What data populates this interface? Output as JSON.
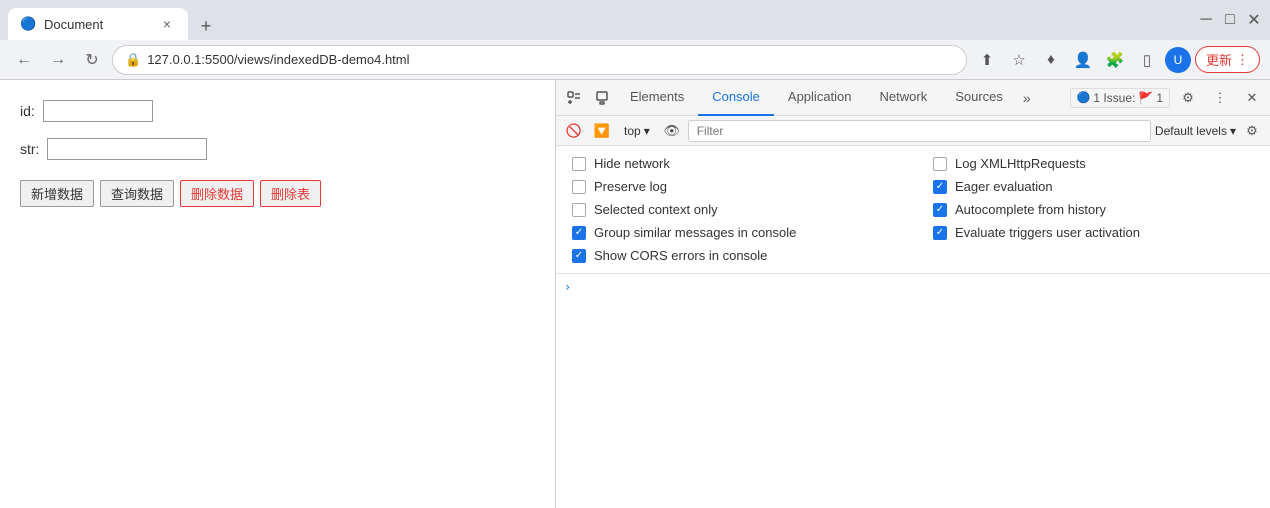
{
  "browser": {
    "tab_title": "Document",
    "tab_favicon": "🔵",
    "address": "127.0.0.1:5500/views/indexedDB-demo4.html",
    "update_btn": "更新",
    "new_tab_icon": "+",
    "nav_back": "←",
    "nav_forward": "→",
    "nav_reload": "↻"
  },
  "window_controls": {
    "minimize": "─",
    "maximize": "□",
    "close": "✕"
  },
  "page": {
    "id_label": "id:",
    "id_placeholder": "",
    "str_label": "str:",
    "str_placeholder": "",
    "btn_add": "新增数据",
    "btn_query": "查询数据",
    "btn_delete_data": "删除数据",
    "btn_delete_table": "删除表"
  },
  "devtools": {
    "tabs": [
      "Elements",
      "Console",
      "Application",
      "Network",
      "Sources",
      "»"
    ],
    "active_tab": "Console",
    "issues_label": "1 Issue:",
    "issues_count": "1",
    "toolbar": {
      "top_label": "top",
      "filter_placeholder": "Filter",
      "default_levels": "Default levels"
    },
    "dropdown": {
      "items_left": [
        {
          "label": "Hide network",
          "checked": false
        },
        {
          "label": "Preserve log",
          "checked": false
        },
        {
          "label": "Selected context only",
          "checked": false
        },
        {
          "label": "Group similar messages in console",
          "checked": true
        },
        {
          "label": "Show CORS errors in console",
          "checked": true
        }
      ],
      "items_right": [
        {
          "label": "Log XMLHttpRequests",
          "checked": false
        },
        {
          "label": "Eager evaluation",
          "checked": true
        },
        {
          "label": "Autocomplete from history",
          "checked": true
        },
        {
          "label": "Evaluate triggers user activation",
          "checked": true
        }
      ]
    }
  }
}
